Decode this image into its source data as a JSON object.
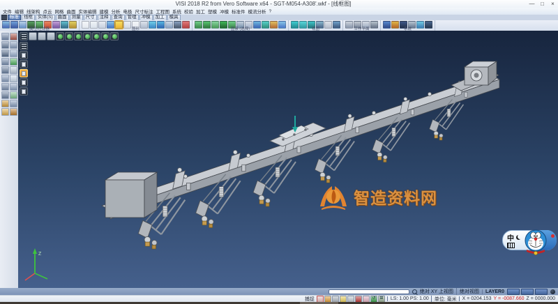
{
  "colors": {
    "accent_orange": "#e09440",
    "status_negative": "#cc2020",
    "viewport_top": "#17253e",
    "viewport_bottom": "#45608c",
    "layer_button_blue": "#43659c"
  },
  "titlebar": {
    "title": "VISI 2018 R2 from Vero Software x64 - SGT-M054-A308'.wkf - [线框图]",
    "minimize": "—",
    "maximize": "□",
    "close": "×"
  },
  "menubar": {
    "items": [
      "文件",
      "编辑",
      "线架构",
      "点云",
      "网格",
      "曲面",
      "实体编辑",
      "建模",
      "分析",
      "电极",
      "尺寸标注",
      "工程图",
      "系统",
      "校验",
      "加工",
      "塑模",
      "冲模",
      "标准件",
      "模流分析",
      "?"
    ]
  },
  "tabstrip": {
    "active": "标准",
    "items": [
      "标准",
      "线框",
      "实体(S)",
      "曲面",
      "测量",
      "尺寸",
      "注释",
      "查询",
      "管理",
      "冲模",
      "加工",
      "模具"
    ]
  },
  "ribbon": {
    "groups": [
      {
        "label": "属性/过滤器",
        "icons": [
          {
            "c": "#5a7ec0"
          },
          {
            "c": "#4a6ab0"
          },
          {
            "c": "#7aa0d0"
          },
          {
            "c": "#3a6a40"
          },
          {
            "c": "#4a8a50"
          },
          {
            "c": "#d05a40"
          },
          {
            "c": "#8a6ab0"
          },
          {
            "c": "#40809a"
          },
          {
            "c": "#c0a040"
          }
        ]
      },
      {
        "label": "图形",
        "icons": [
          {
            "c": "#e8ecf2"
          },
          {
            "c": "#dfe5ee"
          },
          {
            "c": "#cfd7e4"
          },
          {
            "c": "#5a8ad0"
          },
          {
            "c": "#f0c040",
            "hl": true
          },
          {
            "c": "#d8dee8"
          },
          {
            "c": "#e8ecf2"
          },
          {
            "c": "#bcc6d6"
          },
          {
            "c": "#4a9ad0"
          },
          {
            "c": "#3a7ac0"
          },
          {
            "c": "#9ab0cc"
          },
          {
            "c": "#5a6a80"
          },
          {
            "c": "#c05050"
          }
        ]
      },
      {
        "label": "图素 (选择)",
        "icons": [
          {
            "c": "#4a9a5a"
          },
          {
            "c": "#3a8a4a"
          },
          {
            "c": "#5aaa6a"
          },
          {
            "c": "#2a7a3a"
          },
          {
            "c": "#4a9a5a"
          },
          {
            "c": "#8aa0b8"
          },
          {
            "c": "#b0bcd0"
          },
          {
            "c": "#4a7ac0"
          },
          {
            "c": "#3aa090"
          },
          {
            "c": "#c08040"
          },
          {
            "c": "#5a8ad0"
          }
        ]
      },
      {
        "label": "视图",
        "icons": [
          {
            "c": "#2a9aa0"
          },
          {
            "c": "#3aaab0"
          },
          {
            "c": "#2a8a90"
          },
          {
            "c": "#5a7a9a"
          },
          {
            "c": "#c0c8d4"
          },
          {
            "c": "#4a6a90"
          }
        ]
      },
      {
        "label": "工作平面",
        "icons": [
          {
            "c": "#9aa6b8"
          },
          {
            "c": "#8a96a8"
          },
          {
            "c": "#aab6c8"
          },
          {
            "c": "#7a8698"
          }
        ]
      },
      {
        "label": "系统",
        "icons": [
          {
            "c": "#3a5a9a"
          },
          {
            "c": "#c07a30"
          },
          {
            "c": "#2a3a5a"
          },
          {
            "c": "#7a8aa0"
          },
          {
            "c": "#4a90c0"
          },
          {
            "c": "#30445f"
          }
        ]
      }
    ]
  },
  "toolbox": {
    "icons": [
      "#7a90b0",
      "#b05a50",
      "#6a80a0",
      "#8aa0c0",
      "#5a7090",
      "#9ab0d0",
      "#7a90b0",
      "#50b060",
      "#6a80a0",
      "#c0d0e0",
      "#8aa0c0",
      "#d0e0f0",
      "#7a90b0",
      "#90a6c6",
      "#6a80a0",
      "#80c090",
      "#d4a040",
      "#8aa0c0",
      "#e0b050",
      "#c08030"
    ]
  },
  "float_toolbar": {
    "top": [
      "grid",
      "pale",
      "pale",
      "pale",
      "orb",
      "orb",
      "orb",
      "orb",
      "orb",
      "orb",
      "orb"
    ],
    "side": [
      "grid",
      "page",
      "page",
      "active",
      "page",
      "page"
    ]
  },
  "viewport": {
    "watermark_text": "智造资料网",
    "triad": {
      "z": "Z"
    }
  },
  "ime": {
    "mode": "中"
  },
  "statusbar_top": {
    "view_mode": "绝对 XY 上视图",
    "coord_mode": "绝对视图",
    "layer": "LAYER0",
    "layer_buttons": [
      "",
      "",
      ""
    ]
  },
  "statusbar_bottom": {
    "snap_label": "捕捉",
    "icons": [
      {
        "c": "#e8c0c0",
        "b": "#c05050"
      },
      {
        "c": "#e0a040"
      },
      {
        "c": "#b0b8c0"
      },
      {
        "c": "#e8d060"
      },
      {
        "c": "#c0c8d0"
      },
      {
        "c": "#c04040"
      },
      {
        "c": "#e0b0c0"
      },
      {
        "c": "#40a050",
        "g": "↺"
      },
      {
        "c": "#9ab098",
        "g": "⊞"
      }
    ],
    "scale": "LS: 1.00 PS: 1.00",
    "units": "单位: 毫米",
    "coord_x": "X = 0204.153",
    "coord_y": "Y = -0087.660",
    "coord_z": "Z = 0000.000"
  }
}
